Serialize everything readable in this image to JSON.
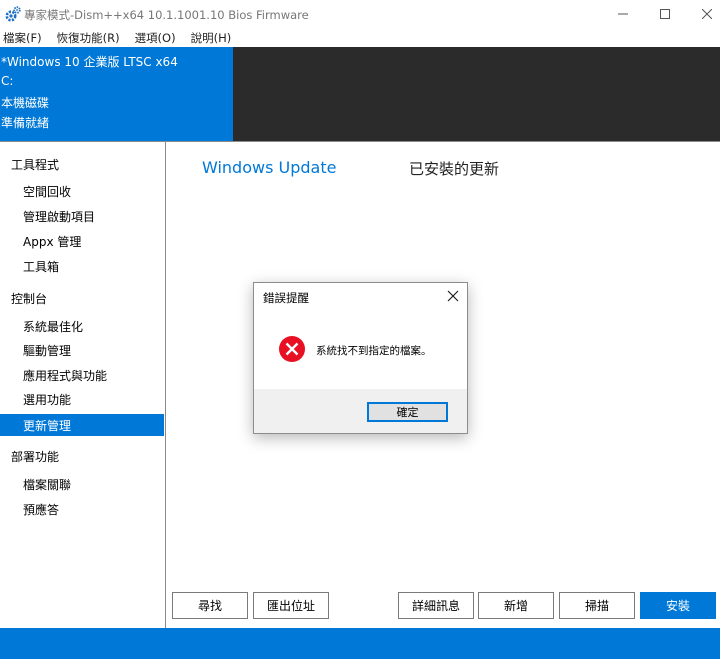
{
  "window": {
    "title": "專家模式-Dism++x64 10.1.1001.10 Bios Firmware"
  },
  "menu": [
    "檔案(F)",
    "恢復功能(R)",
    "選項(O)",
    "說明(H)"
  ],
  "info": {
    "os": "*Windows 10 企業版 LTSC x64",
    "drive": "C:",
    "disk": "本機磁碟",
    "status": "準備就緒"
  },
  "sidebar": {
    "tools": {
      "label": "工具程式",
      "items": [
        "空間回收",
        "管理啟動項目",
        "Appx 管理",
        "工具箱"
      ]
    },
    "console": {
      "label": "控制台",
      "items": [
        "系統最佳化",
        "驅動管理",
        "應用程式與功能",
        "選用功能",
        "更新管理"
      ]
    },
    "deploy": {
      "label": "部署功能",
      "items": [
        "檔案關聯",
        "預應答"
      ]
    },
    "active_item": "更新管理"
  },
  "main": {
    "title": "Windows Update",
    "subtitle": "已安裝的更新",
    "buttons": {
      "find": "尋找",
      "export_location": "匯出位址",
      "details": "詳細訊息",
      "add": "新增",
      "scan": "掃描",
      "install": "安裝"
    }
  },
  "dialog": {
    "title": "錯誤提醒",
    "message": "系統找不到指定的檔案。",
    "ok": "確定"
  },
  "colors": {
    "accent": "#0078d7",
    "dark_panel": "#2b2b2b",
    "error_red": "#e81123"
  }
}
